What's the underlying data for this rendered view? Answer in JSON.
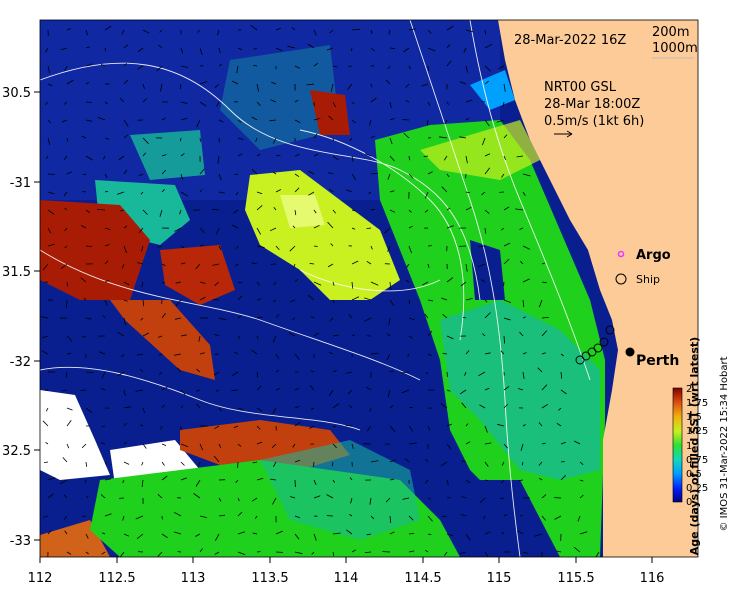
{
  "map": {
    "x_ticks": [
      "112",
      "112.5",
      "113",
      "113.5",
      "114",
      "114.5",
      "115",
      "115.5",
      "116"
    ],
    "y_ticks": [
      "30.5",
      "-31",
      "31.5",
      "-32",
      "32.5",
      "-33"
    ],
    "date_label": "28-Mar-2022 16Z",
    "isobath_labels": [
      "200m",
      "1000m"
    ],
    "current_info": [
      "NRT00 GSL",
      "28-Mar 18:00Z",
      "0.5m/s (1kt 6h)"
    ],
    "legend": {
      "argo": "Argo",
      "ship": "Ship"
    },
    "city": "Perth",
    "colorbar": {
      "ticks": [
        "2",
        "1.75",
        "1.5",
        "1.25",
        "1",
        "0.75",
        "0.5",
        "0.25",
        "0"
      ],
      "title": "Age (days) of filled SST (wrt latest)",
      "range": [
        0,
        2
      ]
    },
    "credit": "© IMOS 31-Mar-2022 15:34 Hobart",
    "colors": {
      "ocean_deep": "#0a1f8f",
      "land": "#fdcb98",
      "green": "#1fd11c",
      "teal": "#18b89a",
      "yellow_green": "#c9f020",
      "brown": "#a81c06",
      "orange": "#d0621a",
      "argo": "#e040ff"
    }
  }
}
